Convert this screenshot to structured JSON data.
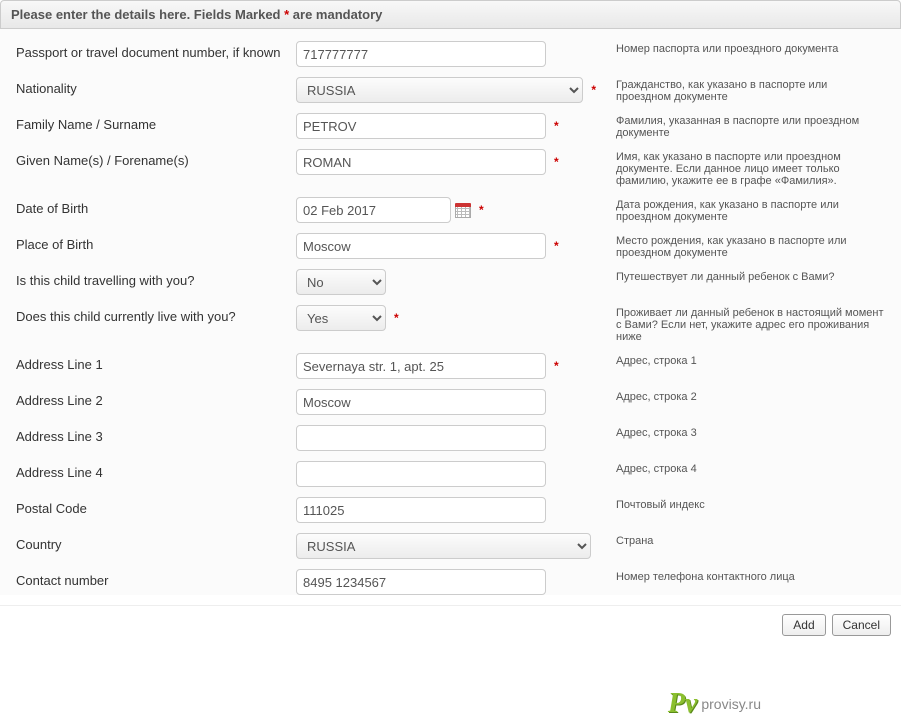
{
  "header": {
    "prefix": "Please enter the details here. Fields Marked ",
    "asterisk": "*",
    "suffix": " are mandatory"
  },
  "fields": {
    "passport": {
      "label": "Passport or travel document number, if known",
      "value": "717777777",
      "required": false,
      "help": "Номер паспорта или проездного документа"
    },
    "nationality": {
      "label": "Nationality",
      "value": "RUSSIA",
      "required": true,
      "help": "Гражданство, как указано в паспорте или проездном документе"
    },
    "surname": {
      "label": "Family Name / Surname",
      "value": "PETROV",
      "required": true,
      "help": "Фамилия, указанная в паспорте или проездном документе"
    },
    "given": {
      "label": "Given Name(s) / Forename(s)",
      "value": "ROMAN",
      "required": true,
      "help": "Имя, как указано в паспорте или проездном документе. Если данное лицо имеет только фамилию, укажите ее в графе «Фамилия»."
    },
    "dob": {
      "label": "Date of Birth",
      "value": "02 Feb 2017",
      "required": true,
      "help": "Дата рождения, как указано в паспорте или проездном документе"
    },
    "pob": {
      "label": "Place of Birth",
      "value": "Moscow",
      "required": true,
      "help": "Место рождения, как указано в паспорте или проездном документе"
    },
    "travel": {
      "label": "Is this child travelling with you?",
      "value": "No",
      "required": false,
      "help": "Путешествует ли данный ребенок с Вами?"
    },
    "live": {
      "label": "Does this child currently live with you?",
      "value": "Yes",
      "required": true,
      "help": "Проживает ли данный ребенок в настоящий момент с Вами? Если нет, укажите адрес его проживания ниже"
    },
    "addr1": {
      "label": "Address Line 1",
      "value": "Severnaya str. 1, apt. 25",
      "required": true,
      "help": "Адрес, строка 1"
    },
    "addr2": {
      "label": "Address Line 2",
      "value": "Moscow",
      "required": false,
      "help": "Адрес, строка 2"
    },
    "addr3": {
      "label": "Address Line 3",
      "value": "",
      "required": false,
      "help": "Адрес, строка 3"
    },
    "addr4": {
      "label": "Address Line 4",
      "value": "",
      "required": false,
      "help": "Адрес, строка 4"
    },
    "postal": {
      "label": "Postal Code",
      "value": "111025",
      "required": false,
      "help": "Почтовый индекс"
    },
    "country": {
      "label": "Country",
      "value": "RUSSIA",
      "required": false,
      "help": "Страна"
    },
    "contact": {
      "label": "Contact number",
      "value": "8495 1234567",
      "required": false,
      "help": "Номер телефона контактного лица"
    }
  },
  "footer": {
    "add": "Add",
    "cancel": "Cancel"
  },
  "watermark": {
    "logo": "Pv",
    "text": "provisy.ru"
  }
}
